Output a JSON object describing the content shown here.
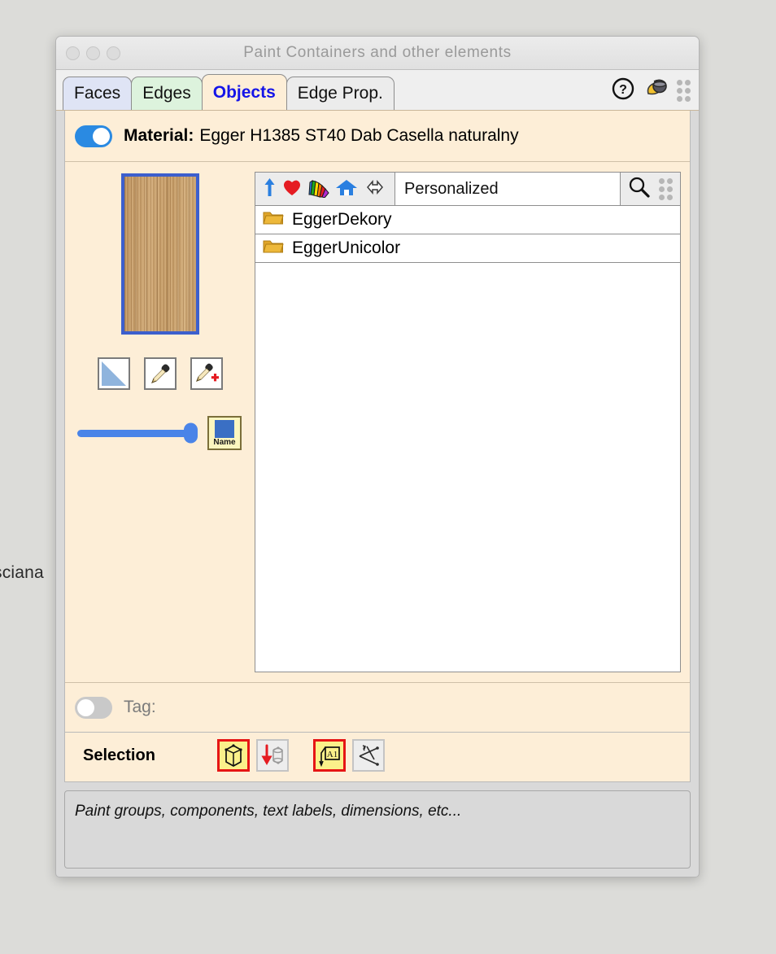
{
  "background": {
    "partial_text": "sciana",
    "desktop_color": "#dcdcd9"
  },
  "window": {
    "title": "Paint Containers and other elements",
    "traffic_lights": [
      "close-dot",
      "minimize-dot",
      "zoom-dot"
    ]
  },
  "tabs": [
    {
      "label": "Faces",
      "active": false,
      "color": "#dfe4f5"
    },
    {
      "label": "Edges",
      "active": false,
      "color": "#ddf3dd"
    },
    {
      "label": "Objects",
      "active": true,
      "color": "#fdeed7"
    },
    {
      "label": "Edge Prop.",
      "active": false,
      "color": "#ececec"
    }
  ],
  "tab_icons": {
    "help": "help-icon",
    "paint": "paint-bucket-icon",
    "grip": "grip-dots-icon"
  },
  "material": {
    "toggle_state": "on",
    "label": "Material:",
    "value": "Egger H1385 ST40 Dab Casella naturalny"
  },
  "left_panel": {
    "swatch": {
      "name": "material-preview-swatch",
      "border_color": "#3c5fcd",
      "base_color": "#c49a63"
    },
    "tools": [
      {
        "name": "gradient-tool-button",
        "icon": "gradient-triangle-icon"
      },
      {
        "name": "eyedropper-tool-button",
        "icon": "eyedropper-icon"
      },
      {
        "name": "eyedropper-add-tool-button",
        "icon": "eyedropper-plus-icon"
      }
    ],
    "slider": {
      "name": "opacity-slider",
      "value": 100,
      "color": "#4a84e8"
    },
    "name_button": {
      "label": "Name",
      "swatch_color": "#3a6fc4",
      "background": "#fbf6bf"
    }
  },
  "browser": {
    "toolbar_icons": [
      {
        "name": "up-arrow-icon",
        "color": "#2a7fe0"
      },
      {
        "name": "favorite-heart-icon",
        "color": "#e51c22"
      },
      {
        "name": "color-fan-icon",
        "color": "#ffd400"
      },
      {
        "name": "home-icon",
        "color": "#2a7fe0"
      },
      {
        "name": "swap-arrows-icon",
        "color": "#ffffff"
      }
    ],
    "search_value": "Personalized",
    "search_icon": "magnifier-icon",
    "grip_icon": "grip-dots-icon",
    "folders": [
      {
        "icon": "folder-icon",
        "name": "EggerDekory"
      },
      {
        "icon": "folder-icon",
        "name": "EggerUnicolor"
      }
    ]
  },
  "tag": {
    "toggle_state": "off",
    "label": "Tag:"
  },
  "selection": {
    "label": "Selection",
    "buttons": [
      {
        "name": "select-groups-button",
        "icon": "cube-icon",
        "active": true
      },
      {
        "name": "select-nested-button",
        "icon": "arrow-down-cube-icon",
        "active": false
      },
      {
        "name": "select-text-labels-button",
        "icon": "text-label-icon",
        "active": true
      },
      {
        "name": "select-dimensions-button",
        "icon": "dimension-axes-icon",
        "active": false
      }
    ]
  },
  "status": {
    "text": "Paint groups, components, text labels, dimensions, etc..."
  }
}
